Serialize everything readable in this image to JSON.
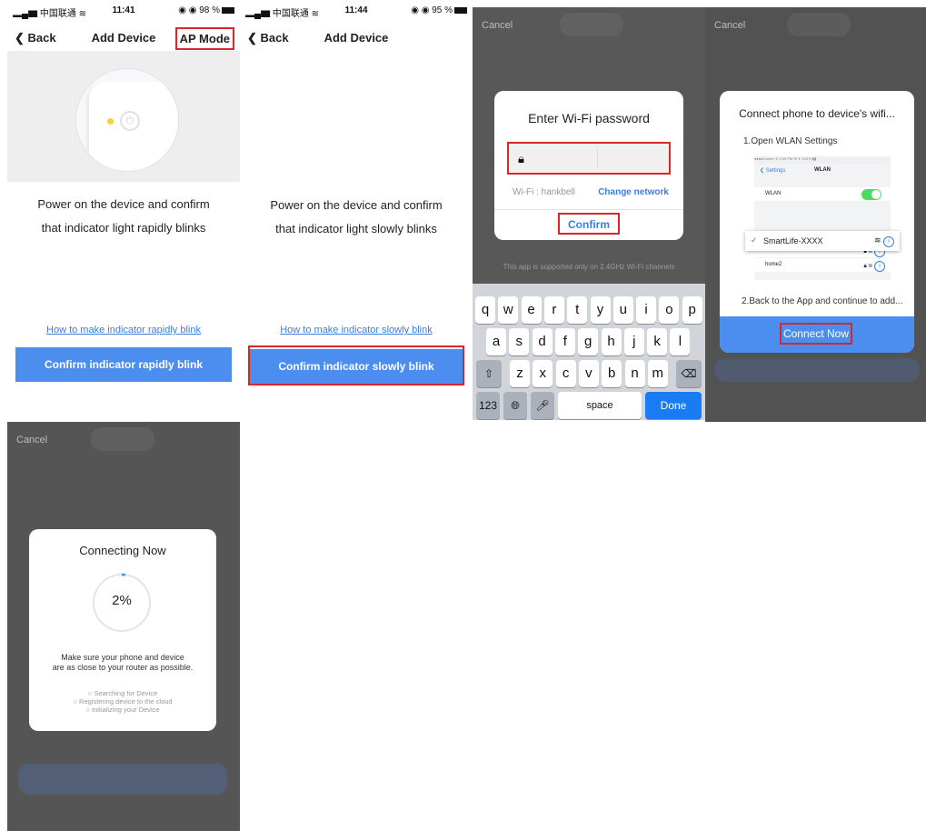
{
  "p1": {
    "status": {
      "carrier": "中国联通",
      "time": "11:41",
      "battery": "98 %"
    },
    "nav": {
      "back": "Back",
      "title": "Add Device",
      "right": "AP Mode"
    },
    "instruction_line1": "Power on the device and confirm",
    "instruction_line2": "that indicator light rapidly blinks",
    "help_link": "How to make indicator rapidly blink",
    "confirm_button": "Confirm indicator rapidly blink"
  },
  "p2": {
    "status": {
      "carrier": "中国联通",
      "time": "11:44",
      "battery": "95 %"
    },
    "nav": {
      "back": "Back",
      "title": "Add Device"
    },
    "instruction_line1": "Power on the device and confirm",
    "instruction_line2": "that indicator light slowly blinks",
    "help_link": "How to make indicator slowly blink",
    "confirm_button": "Confirm indicator slowly blink"
  },
  "p3": {
    "cancel": "Cancel",
    "dialog_title": "Enter Wi-Fi password",
    "wifi_label": "Wi-Fi : hankbell",
    "change_network": "Change network",
    "confirm": "Confirm",
    "note": "This app is supported only on 2.4GHz Wi-Fi channels",
    "keyboard": {
      "row1": [
        "q",
        "w",
        "e",
        "r",
        "t",
        "y",
        "u",
        "i",
        "o",
        "p"
      ],
      "row2": [
        "a",
        "s",
        "d",
        "f",
        "g",
        "h",
        "j",
        "k",
        "l"
      ],
      "row3": [
        "z",
        "x",
        "c",
        "v",
        "b",
        "n",
        "m"
      ],
      "num": "123",
      "space": "space",
      "done": "Done"
    }
  },
  "p4": {
    "cancel": "Cancel",
    "title": "Connect phone to device's wifi...",
    "step1": "1.Open WLAN Settings",
    "shot": {
      "status": "●●●●Carrier ✈  2:49 PM  ⊕ ✈ 100% ▮▮",
      "back": "Settings",
      "header": "WLAN",
      "wlan": "WLAN",
      "section": "CHOOSE A NETWORK...",
      "nets": [
        "home",
        "home2"
      ]
    },
    "selected_network": "SmartLife-XXXX",
    "step2": "2.Back to the App and continue to add...",
    "connect_button": "Connect Now"
  },
  "p5": {
    "cancel": "Cancel",
    "title": "Connecting Now",
    "progress_percent": 2,
    "percent_text": "2%",
    "tip_line1": "Make sure your phone and device",
    "tip_line2": "are as close to your router as possible.",
    "steps": [
      "Searching for Device",
      "Registering device to the cloud",
      "Initializing your Device"
    ]
  },
  "colors": {
    "accent": "#4b8ef0",
    "highlight": "#d9262b",
    "keyboard_done": "#1a7cf5"
  }
}
